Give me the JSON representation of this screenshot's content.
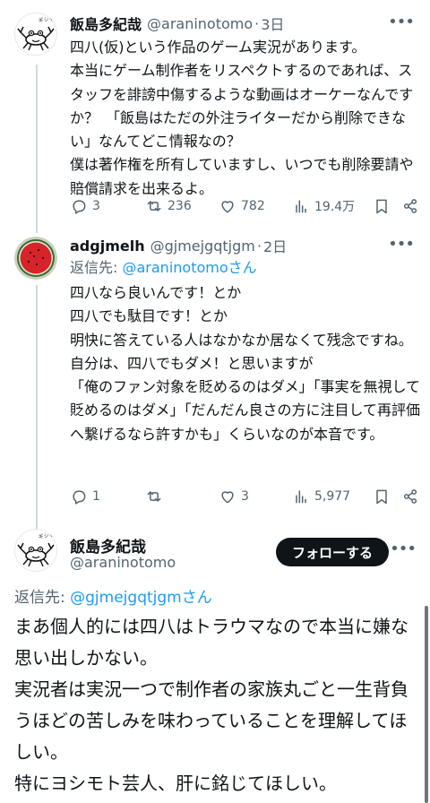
{
  "tweet1": {
    "name": "飯島多紀哉",
    "handle": "@araninotomo",
    "time": "3日",
    "text": "四八(仮)という作品のゲーム実況があります。\n本当にゲーム制作者をリスペクトするのであれば、スタッフを誹謗中傷するような動画はオーケーなんですか？　「飯島はただの外注ライターだから削除できない」なんてどこ情報なの？\n僕は著作権を所有していますし、いつでも削除要請や賠償請求を出来るよ。",
    "replies": "3",
    "retweets": "236",
    "likes": "782",
    "views": "19.4万"
  },
  "tweet2": {
    "name": "adgjmelh",
    "handle": "@gjmejgqtjgm",
    "time": "2日",
    "reply_prefix": "返信先: ",
    "reply_mention": "@araninotomoさん",
    "text": "四八なら良いんです！とか\n四八でも駄目です！とか\n明快に答えている人はなかなか居なくて残念ですね。\n自分は、四八でもダメ！と思いますが\n「俺のファン対象を貶めるのはダメ」「事実を無視して貶めるのはダメ」「だんだん良さの方に注目して再評価へ繋げるなら許すかも」くらいなのが本音です。",
    "replies": "1",
    "likes": "3",
    "views": "5,977"
  },
  "tweet3": {
    "name": "飯島多紀哉",
    "handle": "@araninotomo",
    "follow_label": "フォローする",
    "reply_prefix": "返信先: ",
    "reply_mention": "@gjmejgqtjgmさん",
    "text": "まあ個人的には四八はトラウマなので本当に嫌な思い出しかない。\n実況者は実況一つで制作者の家族丸ごと一生背負うほどの苦しみを味わっていることを理解してほしい。\n特にヨシモト芸人、肝に銘じてほしい。"
  },
  "avatar_text": "ギシャア!!"
}
